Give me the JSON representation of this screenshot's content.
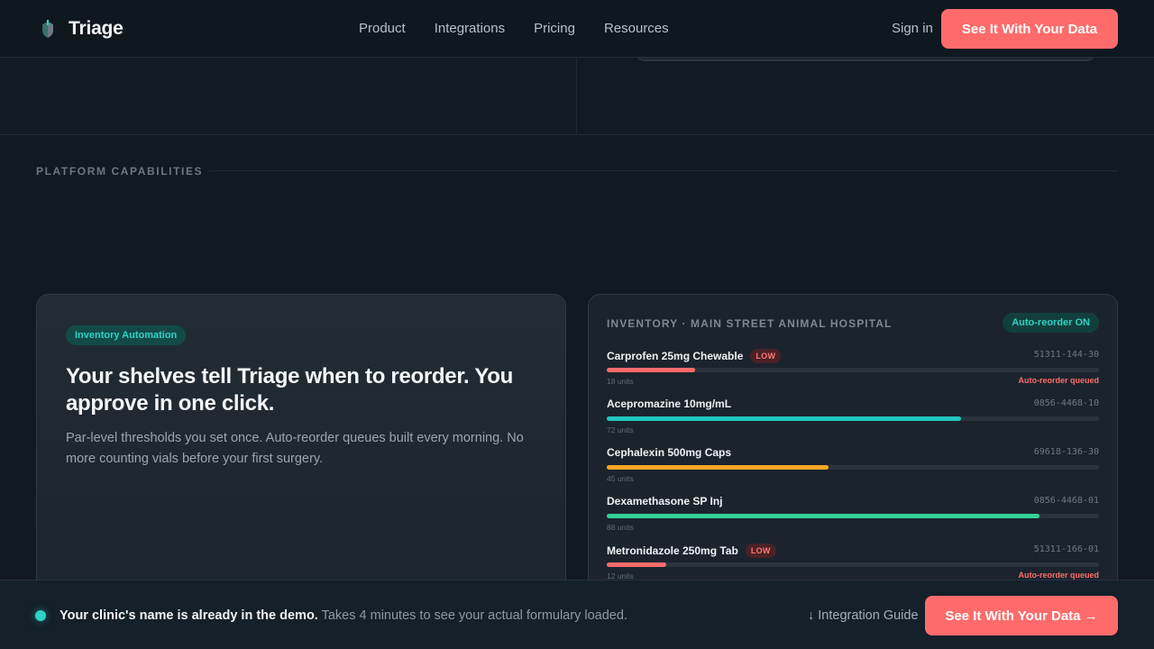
{
  "header": {
    "brand": "Triage",
    "nav": [
      "Product",
      "Integrations",
      "Pricing",
      "Resources"
    ],
    "signin_label": "Sign in",
    "cta_label": "See It With Your Data"
  },
  "section": {
    "label": "PLATFORM CAPABILITIES"
  },
  "feature": {
    "tag": "Inventory Automation",
    "title": "Your shelves tell Triage when to reorder. You approve in one click.",
    "description": "Par-level thresholds you set once. Auto-reorder queues built every morning. No more counting vials before your first surgery."
  },
  "inventory": {
    "title": "INVENTORY · MAIN STREET ANIMAL HOSPITAL",
    "badge": "Auto-reorder ON",
    "items": [
      {
        "name": "Carprofen 25mg Chewable",
        "low": "LOW",
        "code": "51311-144-30",
        "units": "18 units",
        "level": 0.18,
        "color": "#ff6b6b",
        "status": "Auto-reorder queued"
      },
      {
        "name": "Acepromazine 10mg/mL",
        "low": "",
        "code": "0856-4468-10",
        "units": "72 units",
        "level": 0.72,
        "color": "#22c7c0",
        "status": ""
      },
      {
        "name": "Cephalexin 500mg Caps",
        "low": "",
        "code": "69618-136-30",
        "units": "45 units",
        "level": 0.45,
        "color": "#f5a623",
        "status": ""
      },
      {
        "name": "Dexamethasone SP Inj",
        "low": "",
        "code": "0856-4468-01",
        "units": "88 units",
        "level": 0.88,
        "color": "#34d399",
        "status": ""
      },
      {
        "name": "Metronidazole 250mg Tab",
        "low": "LOW",
        "code": "51311-166-01",
        "units": "12 units",
        "level": 0.12,
        "color": "#ff6b6b",
        "status": "Auto-reorder queued"
      }
    ]
  },
  "bottom_bar": {
    "headline": "Your clinic's name is already in the demo.",
    "subtext": "Takes 4 minutes to see your actual formulary loaded.",
    "guide_label": "↓ Integration Guide",
    "cta_label": "See It With Your Data →"
  },
  "colors": {
    "accent": "#ff6b6b",
    "teal": "#2ed3c2",
    "background": "#111a22"
  }
}
